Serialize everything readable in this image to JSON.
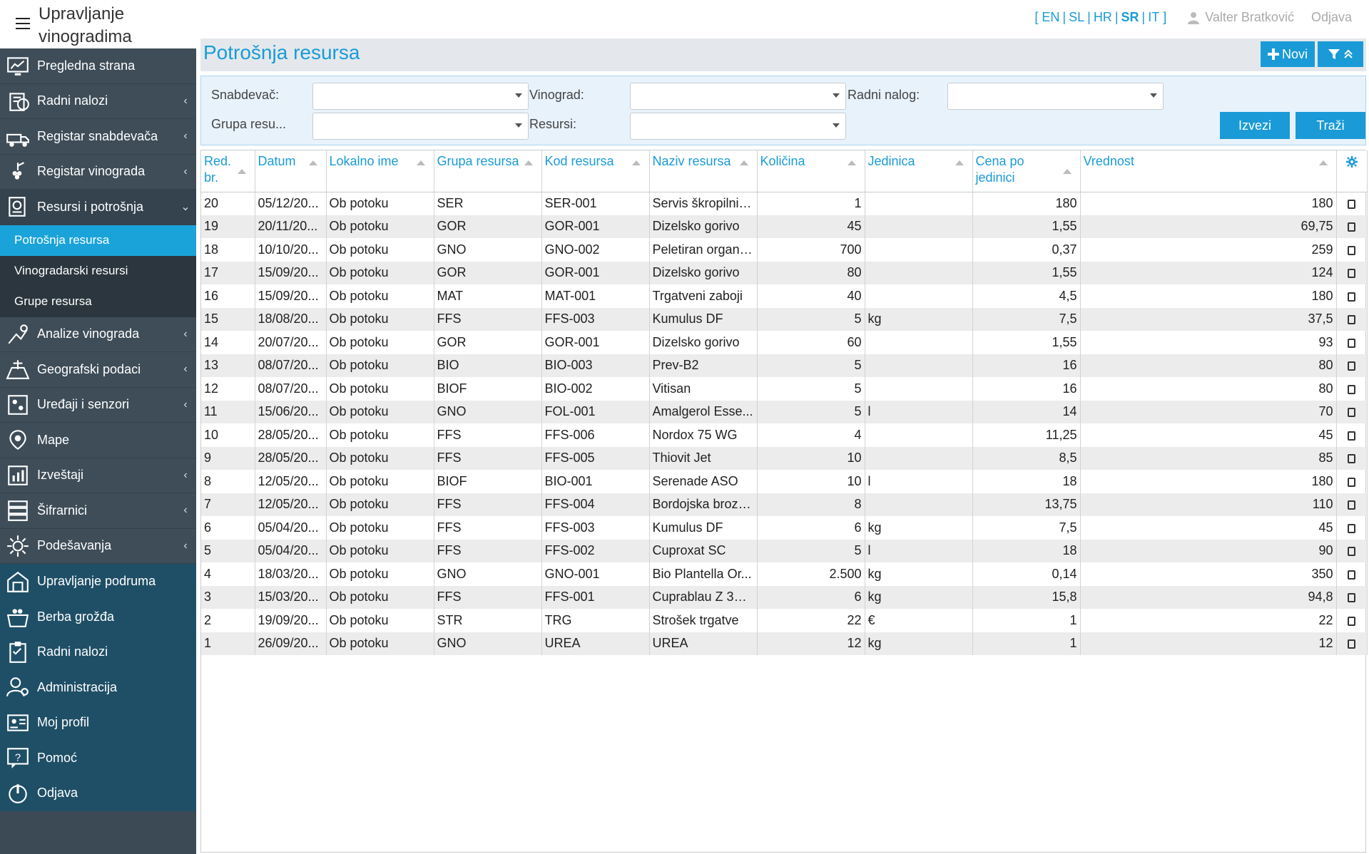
{
  "app": {
    "title": "Upravljanje vinogradima"
  },
  "top": {
    "languages": [
      {
        "code": "EN",
        "selected": false
      },
      {
        "code": "SL",
        "selected": false
      },
      {
        "code": "HR",
        "selected": false
      },
      {
        "code": "SR",
        "selected": true
      },
      {
        "code": "IT",
        "selected": false
      }
    ],
    "open_bracket": "[",
    "close_bracket": "]",
    "user_name": "Valter Bratković",
    "logout": "Odjava"
  },
  "sidebar": {
    "items": [
      {
        "label": "Pregledna strana",
        "icon": "dashboard-icon",
        "chevron": ""
      },
      {
        "label": "Radni nalozi",
        "icon": "work-order-icon",
        "chevron": "‹"
      },
      {
        "label": "Registar snabdevača",
        "icon": "supplier-icon",
        "chevron": "‹"
      },
      {
        "label": "Registar vinograda",
        "icon": "vineyard-icon",
        "chevron": "‹"
      },
      {
        "label": "Resursi i potrošnja",
        "icon": "resources-icon",
        "chevron": "⌄"
      }
    ],
    "sub_items": [
      {
        "label": "Potrošnja resursa",
        "active": true
      },
      {
        "label": "Vinogradarski resursi",
        "active": false
      },
      {
        "label": "Grupe resursa",
        "active": false
      }
    ],
    "items2": [
      {
        "label": "Analize vinograda",
        "icon": "analysis-icon",
        "chevron": "‹"
      },
      {
        "label": "Geografski podaci",
        "icon": "geo-icon",
        "chevron": "‹"
      },
      {
        "label": "Uređaji i senzori",
        "icon": "sensor-icon",
        "chevron": "‹"
      },
      {
        "label": "Mape",
        "icon": "map-icon",
        "chevron": ""
      },
      {
        "label": "Izveštaji",
        "icon": "report-icon",
        "chevron": "‹"
      },
      {
        "label": "Šifrarnici",
        "icon": "codebook-icon",
        "chevron": "‹"
      },
      {
        "label": "Podešavanja",
        "icon": "settings-icon",
        "chevron": "‹"
      }
    ],
    "items3": [
      {
        "label": "Upravljanje podruma",
        "icon": "cellar-icon"
      },
      {
        "label": "Berba grožđa",
        "icon": "harvest-icon"
      },
      {
        "label": "Radni nalozi",
        "icon": "clipboard-icon"
      },
      {
        "label": "Administracija",
        "icon": "admin-icon"
      },
      {
        "label": "Moj profil",
        "icon": "profile-icon"
      },
      {
        "label": "Pomoć",
        "icon": "help-icon"
      },
      {
        "label": "Odjava",
        "icon": "power-icon"
      }
    ]
  },
  "page": {
    "title": "Potrošnja resursa",
    "new_button": "Novi"
  },
  "filters": {
    "supplier_label": "Snabdevač:",
    "vineyard_label": "Vinograd:",
    "work_order_label": "Radni nalog:",
    "group_label": "Grupa resu...",
    "resources_label": "Resursi:",
    "export_button": "Izvezi",
    "search_button": "Traži"
  },
  "table": {
    "headers": [
      "Red. br.",
      "Datum",
      "Lokalno ime",
      "Grupa resursa",
      "Kod resursa",
      "Naziv resursa",
      "Količina",
      "Jedinica",
      "Cena po jedinici",
      "Vrednost"
    ],
    "rows": [
      [
        "20",
        "05/12/20...",
        "Ob potoku",
        "SER",
        "SER-001",
        "Servis škropilnic...",
        "1",
        "",
        "180",
        "180"
      ],
      [
        "19",
        "20/11/20...",
        "Ob potoku",
        "GOR",
        "GOR-001",
        "Dizelsko gorivo",
        "45",
        "",
        "1,55",
        "69,75"
      ],
      [
        "18",
        "10/10/20...",
        "Ob potoku",
        "GNO",
        "GNO-002",
        "Peletiran organs...",
        "700",
        "",
        "0,37",
        "259"
      ],
      [
        "17",
        "15/09/20...",
        "Ob potoku",
        "GOR",
        "GOR-001",
        "Dizelsko gorivo",
        "80",
        "",
        "1,55",
        "124"
      ],
      [
        "16",
        "15/09/20...",
        "Ob potoku",
        "MAT",
        "MAT-001",
        "Trgatveni zaboji",
        "40",
        "",
        "4,5",
        "180"
      ],
      [
        "15",
        "18/08/20...",
        "Ob potoku",
        "FFS",
        "FFS-003",
        "Kumulus DF",
        "5",
        "kg",
        "7,5",
        "37,5"
      ],
      [
        "14",
        "20/07/20...",
        "Ob potoku",
        "GOR",
        "GOR-001",
        "Dizelsko gorivo",
        "60",
        "",
        "1,55",
        "93"
      ],
      [
        "13",
        "08/07/20...",
        "Ob potoku",
        "BIO",
        "BIO-003",
        "Prev-B2",
        "5",
        "",
        "16",
        "80"
      ],
      [
        "12",
        "08/07/20...",
        "Ob potoku",
        "BIOF",
        "BIO-002",
        "Vitisan",
        "5",
        "",
        "16",
        "80"
      ],
      [
        "11",
        "15/06/20...",
        "Ob potoku",
        "GNO",
        "FOL-001",
        "Amalgerol Esse...",
        "5",
        "l",
        "14",
        "70"
      ],
      [
        "10",
        "28/05/20...",
        "Ob potoku",
        "FFS",
        "FFS-006",
        "Nordox 75 WG",
        "4",
        "",
        "11,25",
        "45"
      ],
      [
        "9",
        "28/05/20...",
        "Ob potoku",
        "FFS",
        "FFS-005",
        "Thiovit Jet",
        "10",
        "",
        "8,5",
        "85"
      ],
      [
        "8",
        "12/05/20...",
        "Ob potoku",
        "BIOF",
        "BIO-001",
        "Serenade ASO",
        "10",
        "l",
        "18",
        "180"
      ],
      [
        "7",
        "12/05/20...",
        "Ob potoku",
        "FFS",
        "FFS-004",
        "Bordojska brozg...",
        "8",
        "",
        "13,75",
        "110"
      ],
      [
        "6",
        "05/04/20...",
        "Ob potoku",
        "FFS",
        "FFS-003",
        "Kumulus DF",
        "6",
        "kg",
        "7,5",
        "45"
      ],
      [
        "5",
        "05/04/20...",
        "Ob potoku",
        "FFS",
        "FFS-002",
        "Cuproxat SC",
        "5",
        "l",
        "18",
        "90"
      ],
      [
        "4",
        "18/03/20...",
        "Ob potoku",
        "GNO",
        "GNO-001",
        "Bio Plantella Or...",
        "2.500",
        "kg",
        "0,14",
        "350"
      ],
      [
        "3",
        "15/03/20...",
        "Ob potoku",
        "FFS",
        "FFS-001",
        "Cuprablau Z 35 ...",
        "6",
        "kg",
        "15,8",
        "94,8"
      ],
      [
        "2",
        "19/09/20...",
        "Ob potoku",
        "STR",
        "TRG",
        "Strošek trgatve",
        "22",
        "€",
        "1",
        "22"
      ],
      [
        "1",
        "26/09/20...",
        "Ob potoku",
        "GNO",
        "UREA",
        "UREA",
        "12",
        "kg",
        "1",
        "12"
      ]
    ]
  },
  "colors": {
    "accent": "#1a9bd7",
    "sidebar": "#3b4a55",
    "sidebar_teal": "#1f4f66"
  }
}
